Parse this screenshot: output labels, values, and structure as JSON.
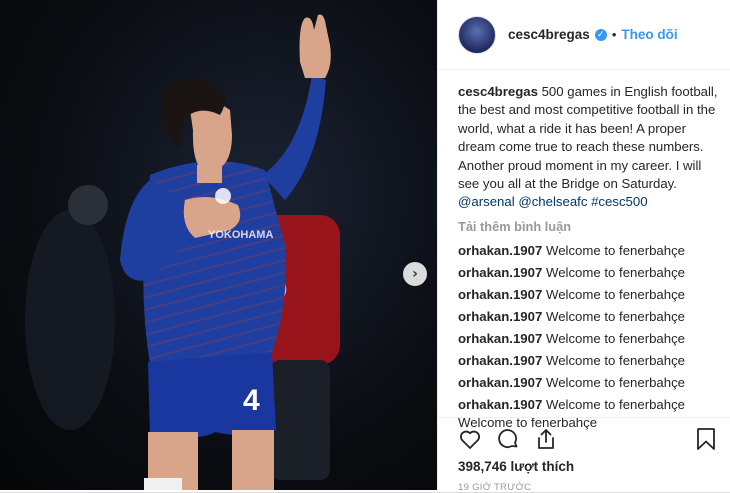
{
  "header": {
    "username": "cesc4bregas",
    "follow_label": "Theo dõi",
    "separator": "•"
  },
  "caption": {
    "author": "cesc4bregas",
    "text": " 500 games in English football, the best and most competitive football in the world, what a ride it has been! A proper dream come true to reach these numbers. Another proud moment in my career. I will see you all at the Bridge on Saturday. ",
    "tags": [
      "@arsenal",
      "@chelseafc",
      "#cesc500"
    ]
  },
  "load_more_label": "Tải thêm bình luận",
  "comments": [
    {
      "author": "orhakan.1907",
      "text": "Welcome to fenerbahçe"
    },
    {
      "author": "orhakan.1907",
      "text": "Welcome to fenerbahçe"
    },
    {
      "author": "orhakan.1907",
      "text": "Welcome to fenerbahçe"
    },
    {
      "author": "orhakan.1907",
      "text": "Welcome to fenerbahçe"
    },
    {
      "author": "orhakan.1907",
      "text": "Welcome to fenerbahçe"
    },
    {
      "author": "orhakan.1907",
      "text": "Welcome to fenerbahçe"
    },
    {
      "author": "orhakan.1907",
      "text": "Welcome to fenerbahçe"
    },
    {
      "author": "orhakan.1907",
      "text": "Welcome to fenerbahçe"
    }
  ],
  "comment_tail": "Welcome to fenerbahçe",
  "likes": "398,746 lượt thích",
  "time": "19 GIỜ TRƯỚC",
  "icons": {
    "like": "heart-icon",
    "comment": "comment-icon",
    "share": "share-icon",
    "save": "bookmark-icon",
    "next": "chevron-right-icon",
    "verified": "verified-badge-icon"
  },
  "colors": {
    "link": "#3897f0",
    "tag": "#003569",
    "muted": "#999999",
    "kit": "#1e3fa0"
  }
}
